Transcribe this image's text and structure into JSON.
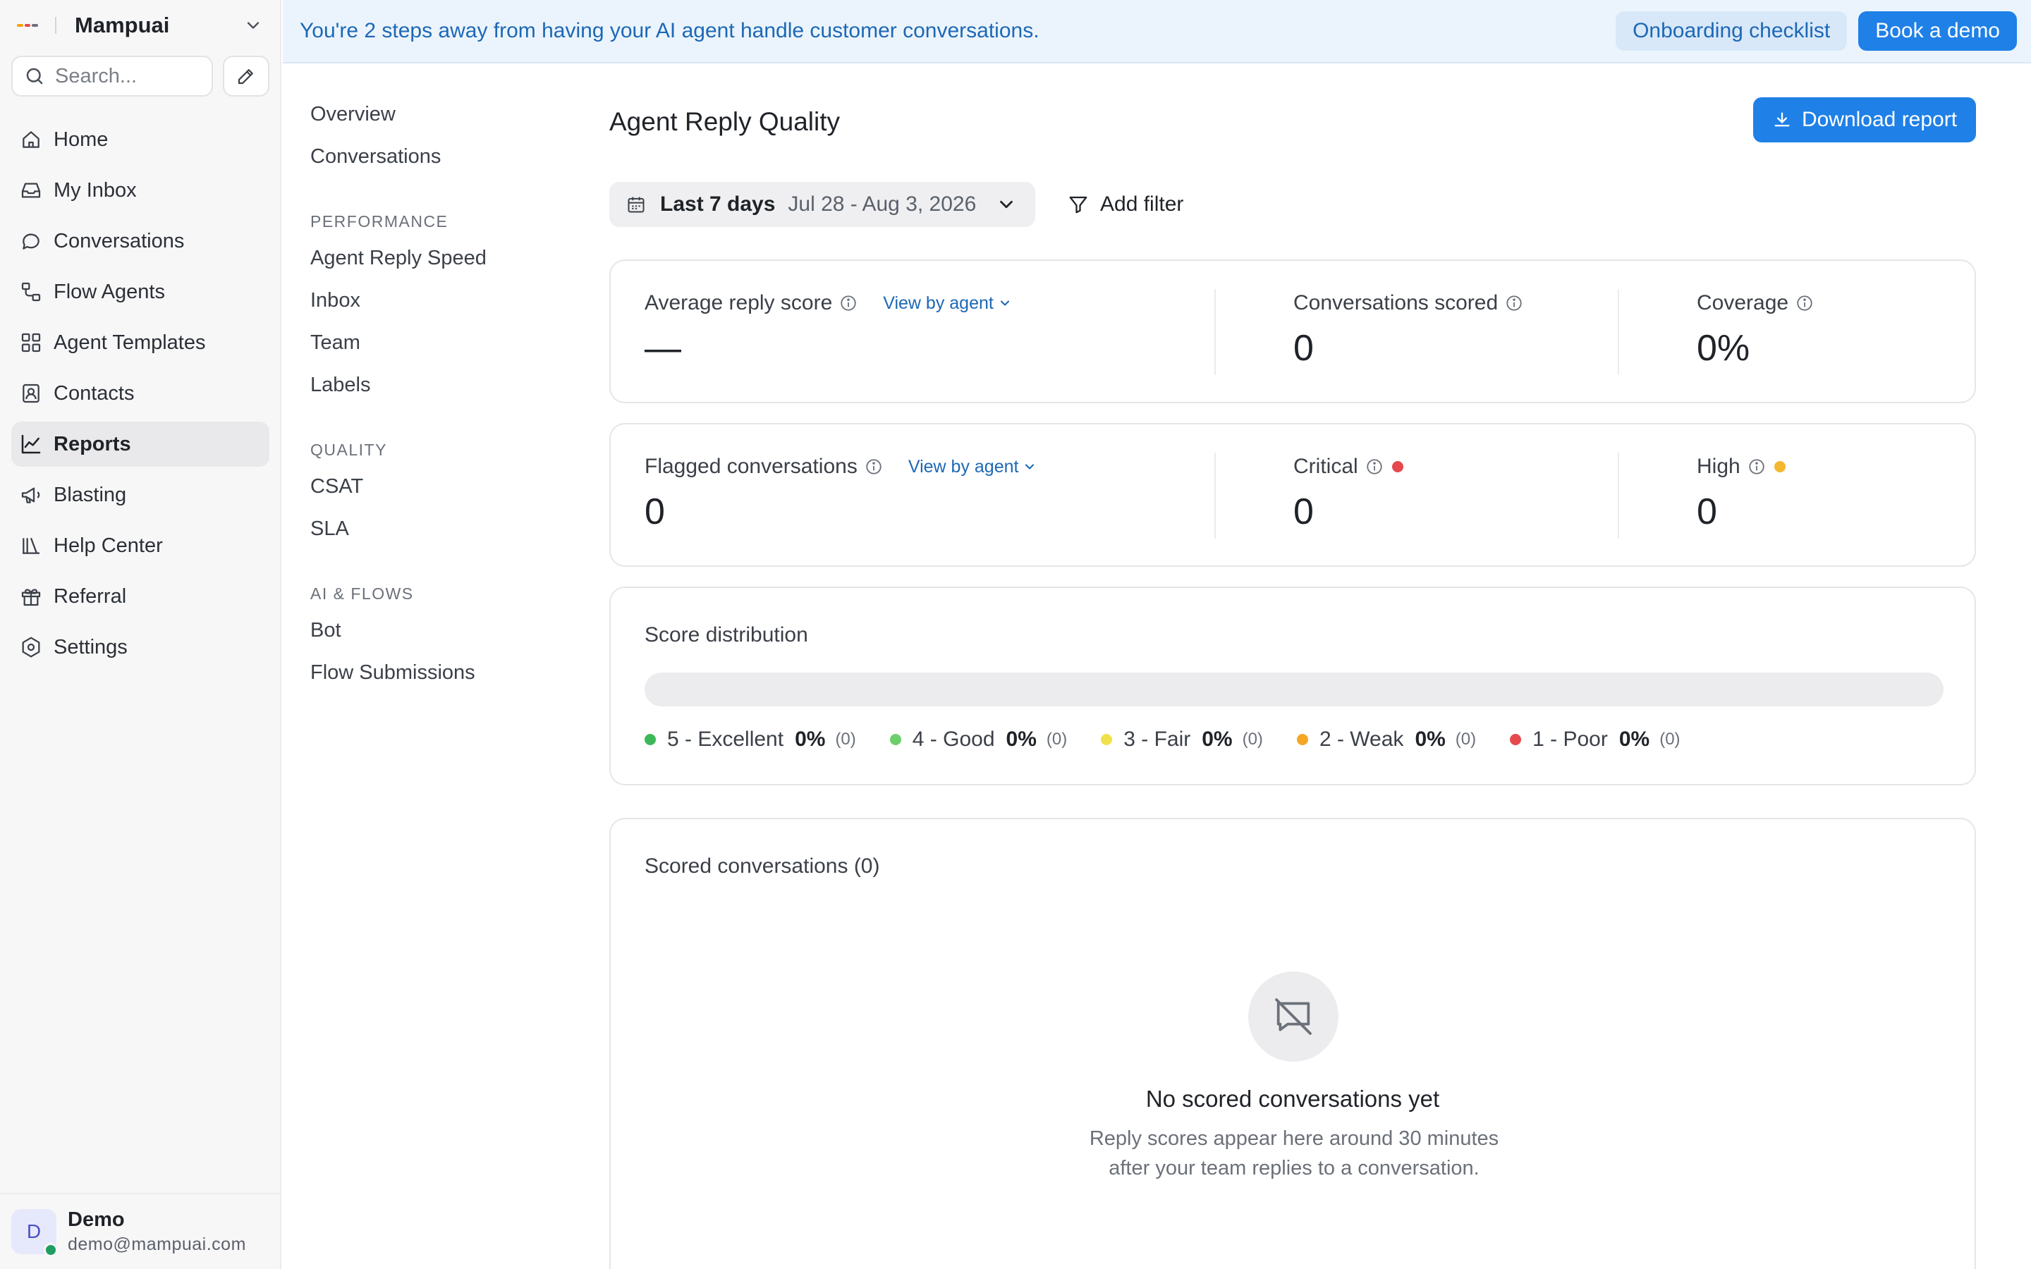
{
  "workspace": {
    "name": "Mampuai",
    "logo_colors": [
      "#f2a20c",
      "#e5484d",
      "#6b7079"
    ]
  },
  "search": {
    "placeholder": "Search..."
  },
  "sidebar": {
    "items": [
      {
        "label": "Home",
        "icon": "home-icon"
      },
      {
        "label": "My Inbox",
        "icon": "inbox-icon"
      },
      {
        "label": "Conversations",
        "icon": "chat-bubble-icon"
      },
      {
        "label": "Flow Agents",
        "icon": "flow-icon"
      },
      {
        "label": "Agent Templates",
        "icon": "grid-icon"
      },
      {
        "label": "Contacts",
        "icon": "contact-card-icon"
      },
      {
        "label": "Reports",
        "icon": "line-chart-icon",
        "active": true
      },
      {
        "label": "Blasting",
        "icon": "megaphone-icon"
      },
      {
        "label": "Help Center",
        "icon": "library-icon"
      },
      {
        "label": "Referral",
        "icon": "gift-icon"
      },
      {
        "label": "Settings",
        "icon": "gear-icon"
      }
    ]
  },
  "user": {
    "initial": "D",
    "name": "Demo",
    "email": "demo@mampuai.com",
    "status_color": "#1f9d63"
  },
  "banner": {
    "text": "You're 2 steps away from having your AI agent handle customer conversations.",
    "onboarding_label": "Onboarding checklist",
    "demo_label": "Book a demo"
  },
  "subnav": {
    "top": [
      "Overview",
      "Conversations"
    ],
    "performance_heading": "PERFORMANCE",
    "performance": [
      "Agent Reply Speed",
      "Inbox",
      "Team",
      "Labels"
    ],
    "quality_heading": "QUALITY",
    "quality": [
      "CSAT",
      "SLA"
    ],
    "ai_heading": "AI & FLOWS",
    "ai": [
      "Bot",
      "Flow Submissions"
    ]
  },
  "main": {
    "title": "Agent Reply Quality",
    "download_label": "Download report",
    "date_range_label": "Last 7 days",
    "date_span": "Jul 28 - Aug 3, 2026",
    "add_filter_label": "Add filter",
    "summary": {
      "avg_label": "Average reply score",
      "avg_value": "—",
      "view_by_agent": "View by agent",
      "scored_label": "Conversations scored",
      "scored_value": "0",
      "coverage_label": "Coverage",
      "coverage_value": "0%"
    },
    "flagged": {
      "label": "Flagged conversations",
      "value": "0",
      "view_by_agent": "View by agent",
      "critical_label": "Critical",
      "critical_value": "0",
      "critical_color": "#e5484d",
      "high_label": "High",
      "high_value": "0",
      "high_color": "#f5b72f"
    },
    "distribution": {
      "title": "Score distribution",
      "items": [
        {
          "label": "5 - Excellent",
          "pct": "0%",
          "count": "(0)",
          "color": "#3cb85a"
        },
        {
          "label": "4 - Good",
          "pct": "0%",
          "count": "(0)",
          "color": "#6dcf6b"
        },
        {
          "label": "3 - Fair",
          "pct": "0%",
          "count": "(0)",
          "color": "#f2e04a"
        },
        {
          "label": "2 - Weak",
          "pct": "0%",
          "count": "(0)",
          "color": "#f5a623"
        },
        {
          "label": "1 - Poor",
          "pct": "0%",
          "count": "(0)",
          "color": "#e5484d"
        }
      ]
    },
    "scored": {
      "title": "Scored conversations (0)",
      "empty_title": "No scored conversations yet",
      "empty_desc": "Reply scores appear here around 30 minutes after your team replies to a conversation."
    }
  }
}
